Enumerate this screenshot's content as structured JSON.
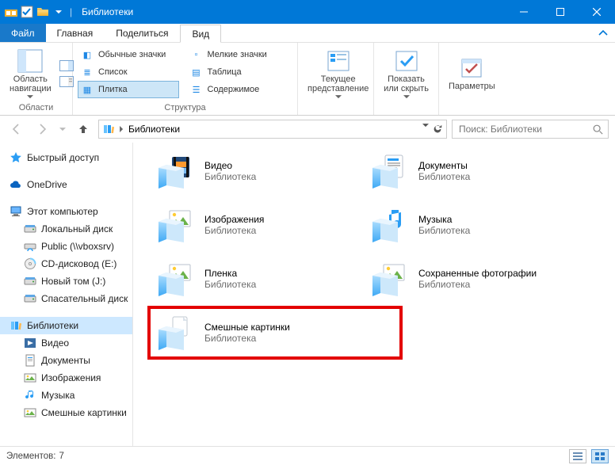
{
  "title": "Библиотеки",
  "tabs": {
    "file": "Файл",
    "home": "Главная",
    "share": "Поделиться",
    "view": "Вид"
  },
  "ribbon": {
    "panes_label": "Области",
    "nav_pane": "Область навигации",
    "layout_label": "Структура",
    "opts": {
      "regular": "Обычные значки",
      "small": "Мелкие значки",
      "list": "Список",
      "table": "Таблица",
      "tiles": "Плитка",
      "content": "Содержимое"
    },
    "current_view": "Текущее представление",
    "show_hide": "Показать или скрыть",
    "options": "Параметры"
  },
  "addr": {
    "crumb": "Библиотеки"
  },
  "search_placeholder": "Поиск: Библиотеки",
  "sidebar": {
    "quick": "Быстрый доступ",
    "onedrive": "OneDrive",
    "thispc": "Этот компьютер",
    "local": "Локальный диск",
    "public": "Public (\\\\vboxsrv)",
    "cd": "CD-дисковод (E:)",
    "voltom": "Новый том (J:)",
    "rescue": "Спасательный диск",
    "libraries": "Библиотеки",
    "video": "Видео",
    "docs": "Документы",
    "images": "Изображения",
    "music": "Музыка",
    "funny": "Смешные картинки"
  },
  "items": [
    {
      "title": "Видео",
      "sub": "Библиотека",
      "icon": "video"
    },
    {
      "title": "Документы",
      "sub": "Библиотека",
      "icon": "docs"
    },
    {
      "title": "Изображения",
      "sub": "Библиотека",
      "icon": "images"
    },
    {
      "title": "Музыка",
      "sub": "Библиотека",
      "icon": "music"
    },
    {
      "title": "Пленка",
      "sub": "Библиотека",
      "icon": "images"
    },
    {
      "title": "Сохраненные фотографии",
      "sub": "Библиотека",
      "icon": "images"
    },
    {
      "title": "Смешные картинки",
      "sub": "Библиотека",
      "icon": "generic"
    }
  ],
  "status": {
    "label": "Элементов:",
    "count": "7"
  }
}
